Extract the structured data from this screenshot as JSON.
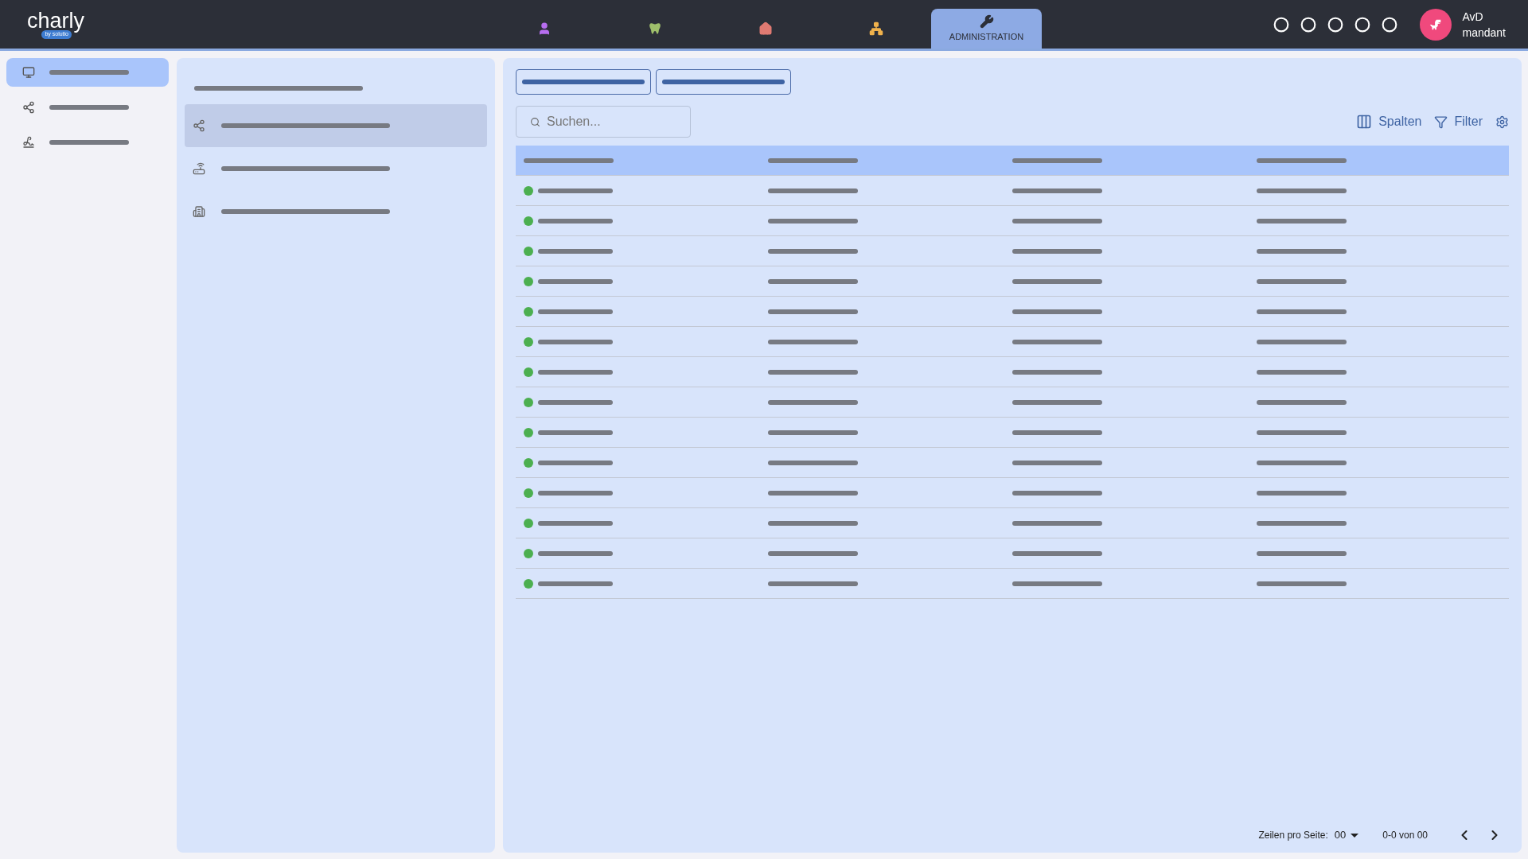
{
  "logo": {
    "name": "charly",
    "tagline": "by solutio"
  },
  "nav_tabs": [
    {
      "kind": "person",
      "selected": false
    },
    {
      "kind": "tooth",
      "selected": false
    },
    {
      "kind": "home",
      "selected": false
    },
    {
      "kind": "hierarchy",
      "selected": false
    },
    {
      "kind": "tools",
      "label": "ADMINISTRATION",
      "selected": true
    }
  ],
  "user": {
    "line1": "AvD",
    "line2": "mandant"
  },
  "sidebar": {
    "items": [
      {
        "kind": "monitor",
        "selected": true
      },
      {
        "kind": "network",
        "selected": false
      },
      {
        "kind": "signature",
        "selected": false
      }
    ]
  },
  "middle_panel": {
    "items": [
      {
        "kind": "network",
        "selected": true
      },
      {
        "kind": "router",
        "selected": false
      },
      {
        "kind": "building",
        "selected": false
      }
    ]
  },
  "toolbar": {
    "search": {
      "placeholder": "Suchen..."
    },
    "columns_button": "Spalten",
    "filter_button": "Filter"
  },
  "table": {
    "rows": [
      {
        "color": "#4caf50"
      },
      {
        "color": "#4caf50"
      },
      {
        "color": "#4caf50"
      },
      {
        "color": "#4caf50"
      },
      {
        "color": "#4caf50"
      },
      {
        "color": "#4caf50"
      },
      {
        "color": "#4caf50"
      },
      {
        "color": "#4caf50"
      },
      {
        "color": "#4caf50"
      },
      {
        "color": "#4caf50"
      },
      {
        "color": "#4caf50"
      },
      {
        "color": "#4caf50"
      },
      {
        "color": "#4caf50"
      },
      {
        "color": "#4caf50"
      }
    ]
  },
  "pagination": {
    "rows_label": "Zeilen pro Seite:",
    "rows_value": "00",
    "range": "0-0 von 00"
  }
}
